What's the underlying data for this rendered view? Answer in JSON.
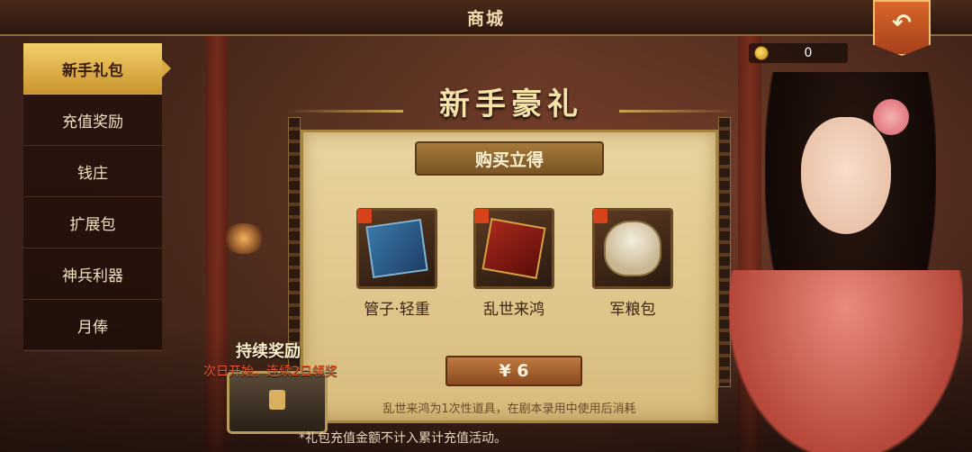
{
  "header": {
    "title": "商城",
    "back_label": "↶"
  },
  "currency": {
    "amount": "0",
    "icon": "gold-coin-icon"
  },
  "sidebar": {
    "items": [
      {
        "label": "新手礼包",
        "active": true
      },
      {
        "label": "充值奖励",
        "active": false
      },
      {
        "label": "钱庄",
        "active": false
      },
      {
        "label": "扩展包",
        "active": false
      },
      {
        "label": "神兵利器",
        "active": false
      },
      {
        "label": "月俸",
        "active": false
      }
    ]
  },
  "gift": {
    "title": "新手豪礼",
    "banner": "购买立得",
    "items": [
      {
        "name": "管子·轻重",
        "icon": "blue-books-icon"
      },
      {
        "name": "乱世来鸿",
        "icon": "red-book-icon"
      },
      {
        "name": "军粮包",
        "icon": "grain-sack-icon"
      }
    ],
    "price": "¥ 6",
    "note": "乱世来鸿为1次性道具，在剧本录用中使用后消耗"
  },
  "continuous": {
    "title": "持续奖励",
    "subtitle": "次日开始，连续2日领奖"
  },
  "footer_note": "*礼包充值金额不计入累计充值活动。",
  "colors": {
    "accent_gold": "#d9a83e",
    "price_button": "#a0602e",
    "highlight_text": "#f05a2a"
  }
}
